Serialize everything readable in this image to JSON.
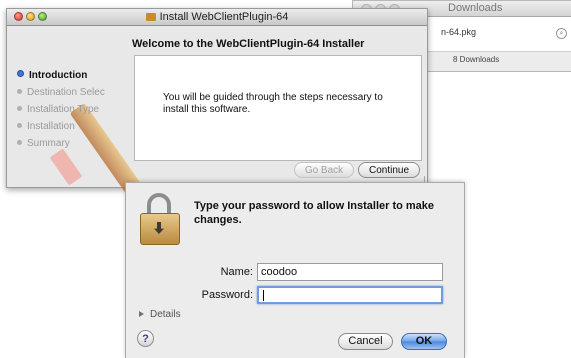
{
  "downloads_window": {
    "title": "Downloads",
    "file_name": "n-64.pkg",
    "count_label": "8 Downloads"
  },
  "installer": {
    "title": "Install WebClientPlugin-64",
    "heading": "Welcome to the WebClientPlugin-64 Installer",
    "message": "You will be guided through the steps necessary to install this software.",
    "steps": [
      {
        "label": "Introduction",
        "active": true
      },
      {
        "label": "Destination Selec",
        "active": false
      },
      {
        "label": "Installation Type",
        "active": false
      },
      {
        "label": "Installation",
        "active": false
      },
      {
        "label": "Summary",
        "active": false
      }
    ],
    "go_back_label": "Go Back",
    "continue_label": "Continue"
  },
  "auth_dialog": {
    "message": "Type your password to allow Installer to make changes.",
    "name_label": "Name:",
    "name_value": "coodoo",
    "password_label": "Password:",
    "password_value": "",
    "details_label": "Details",
    "help_label": "?",
    "cancel_label": "Cancel",
    "ok_label": "OK"
  },
  "colors": {
    "ok_button": "#4d86db",
    "active_step_dot": "#3b78d8",
    "lock_body": "#d4a95e"
  }
}
